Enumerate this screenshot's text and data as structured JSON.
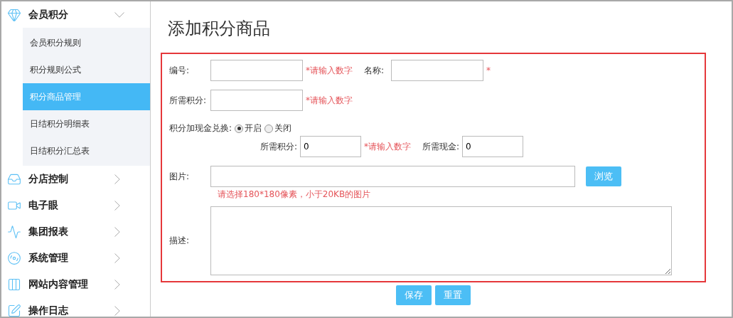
{
  "sidebar": {
    "items": [
      {
        "label": "会员积分",
        "expanded": true,
        "children": [
          {
            "label": "会员积分规则",
            "selected": false
          },
          {
            "label": "积分规则公式",
            "selected": false
          },
          {
            "label": "积分商品管理",
            "selected": true
          },
          {
            "label": "日结积分明细表",
            "selected": false
          },
          {
            "label": "日结积分汇总表",
            "selected": false
          }
        ]
      },
      {
        "label": "分店控制",
        "expanded": false
      },
      {
        "label": "电子眼",
        "expanded": false
      },
      {
        "label": "集团报表",
        "expanded": false
      },
      {
        "label": "系统管理",
        "expanded": false
      },
      {
        "label": "网站内容管理",
        "expanded": false
      },
      {
        "label": "操作日志",
        "expanded": false
      }
    ]
  },
  "page_title": "添加积分商品",
  "form": {
    "code": {
      "label": "编号:",
      "hint": "*请输入数字"
    },
    "name": {
      "label": "名称:",
      "hint": "*"
    },
    "points": {
      "label": "所需积分:",
      "hint": "*请输入数字"
    },
    "exchange": {
      "label": "积分加现金兑换:",
      "options": [
        {
          "label": "开启",
          "selected": true
        },
        {
          "label": "关闭",
          "selected": false
        }
      ]
    },
    "exchange_points": {
      "label": "所需积分:",
      "value": "0",
      "hint": "*请输入数字"
    },
    "exchange_cash": {
      "label": "所需现金:",
      "value": "0"
    },
    "image": {
      "label": "图片:",
      "button": "浏览",
      "hint": "请选择180*180像素，小于20KB的图片"
    },
    "description": {
      "label": "描述:"
    }
  },
  "buttons": [
    "保存",
    "重置"
  ]
}
